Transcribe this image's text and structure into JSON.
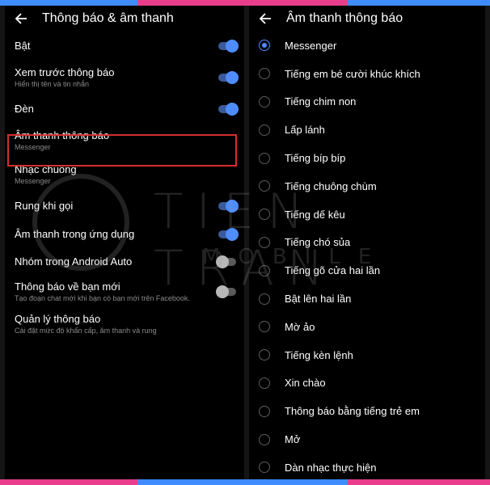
{
  "left_panel": {
    "title": "Thông báo & âm thanh",
    "settings": [
      {
        "title": "Bật",
        "sub": "",
        "toggle": "on"
      },
      {
        "title": "Xem trước thông báo",
        "sub": "Hiển thị tên và tin nhắn",
        "toggle": "on"
      },
      {
        "title": "Đèn",
        "sub": "",
        "toggle": "on"
      },
      {
        "title": "Âm thanh thông báo",
        "sub": "Messenger",
        "toggle": "none"
      },
      {
        "title": "Nhạc chuông",
        "sub": "Messenger",
        "toggle": "none"
      },
      {
        "title": "Rung khi gọi",
        "sub": "",
        "toggle": "on"
      },
      {
        "title": "Âm thanh trong ứng dụng",
        "sub": "",
        "toggle": "on"
      },
      {
        "title": "Nhóm trong Android Auto",
        "sub": "",
        "toggle": "off"
      },
      {
        "title": "Thông báo về bạn mới",
        "sub": "Tạo đoạn chat mới khi bạn có bạn mới trên Facebook.",
        "toggle": "off"
      },
      {
        "title": "Quản lý thông báo",
        "sub": "Cài đặt mức độ khẩn cấp, âm thanh và rung",
        "toggle": "none"
      }
    ]
  },
  "right_panel": {
    "title": "Âm thanh thông báo",
    "selected": "Messenger",
    "options": [
      "Messenger",
      "Tiếng em bé cười khúc khích",
      "Tiếng chim non",
      "Lấp lánh",
      "Tiếng bíp bíp",
      "Tiếng chuông chùm",
      "Tiếng dế kêu",
      "Tiếng chó sủa",
      "Tiếng gõ cửa hai lần",
      "Bật lên hai lần",
      "Mờ ảo",
      "Tiếng kèn lệnh",
      "Xin chào",
      "Thông báo bằng tiếng trẻ em",
      "Mở",
      "Dàn nhạc thực hiện"
    ]
  },
  "watermark": {
    "brand": "TIEN TRAN",
    "sub": "MOBILE"
  },
  "colors": {
    "accent": "#4f8dff",
    "highlight": "#d32f2f",
    "background": "#000000"
  }
}
